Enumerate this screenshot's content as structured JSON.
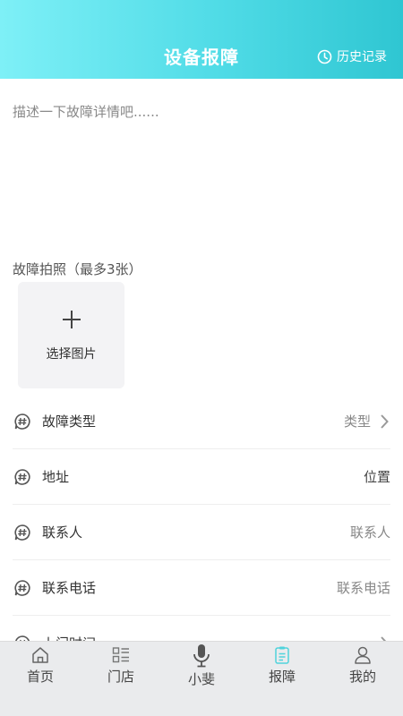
{
  "header": {
    "title": "设备报障",
    "history_label": "历史记录"
  },
  "description": {
    "placeholder": "描述一下故障详情吧......"
  },
  "photos": {
    "label": "故障拍照（最多3张）",
    "add_label": "选择图片"
  },
  "rows": [
    {
      "label": "故障类型",
      "value": "类型",
      "arrow": true
    },
    {
      "label": "地址",
      "value": "位置",
      "arrow": false
    },
    {
      "label": "联系人",
      "value": "联系人",
      "arrow": false
    },
    {
      "label": "联系电话",
      "value": "联系电话",
      "arrow": false
    },
    {
      "label": "上门时间",
      "value": "",
      "arrow": true
    }
  ],
  "tabbar": [
    {
      "label": "首页",
      "icon": "home-icon"
    },
    {
      "label": "门店",
      "icon": "store-list-icon"
    },
    {
      "label": "小斐",
      "icon": "microphone-icon"
    },
    {
      "label": "报障",
      "icon": "report-icon",
      "active": true
    },
    {
      "label": "我的",
      "icon": "user-icon"
    }
  ],
  "colors": {
    "header_start": "#7ef0f7",
    "header_end": "#2fc6d2",
    "active_tab": "#4fd3dc"
  }
}
